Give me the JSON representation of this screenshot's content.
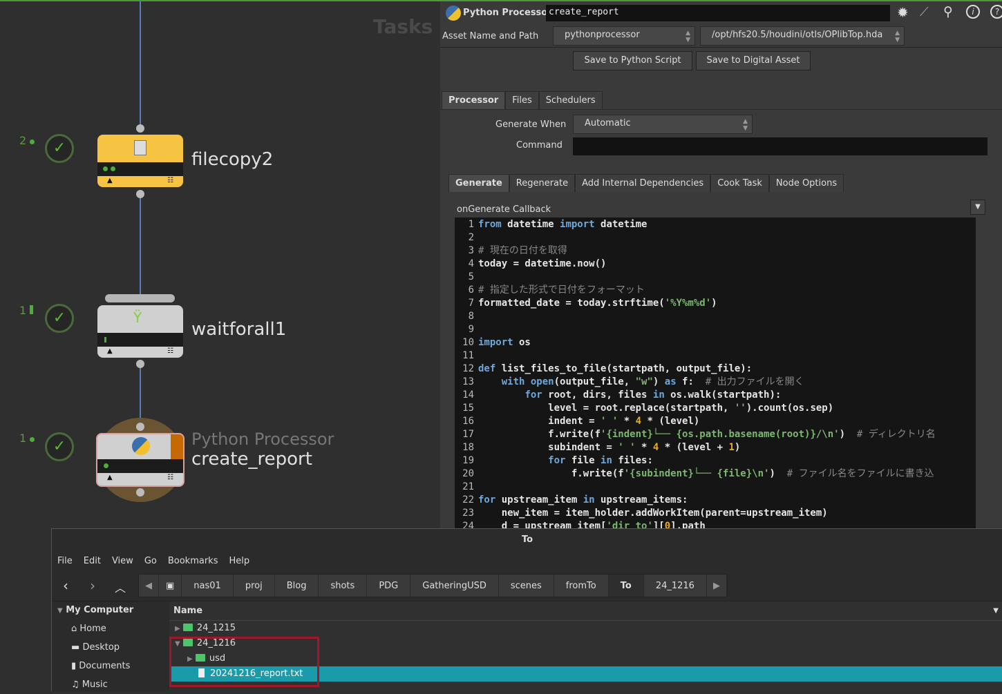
{
  "graph": {
    "watermark": "Tasks",
    "nodes": [
      {
        "name": "filecopy2",
        "count": "2",
        "type": ""
      },
      {
        "name": "waitforall1",
        "count": "1",
        "type": ""
      },
      {
        "name": "create_report",
        "count": "1",
        "type": "Python Processor"
      }
    ]
  },
  "params": {
    "node_type": "Python Processor",
    "node_name": "create_report",
    "asset_label": "Asset Name and Path",
    "asset_name": "pythonprocessor",
    "asset_path": "/opt/hfs20.5/houdini/otls/OPlibTop.hda",
    "save_python": "Save to Python Script",
    "save_asset": "Save to Digital Asset",
    "tabs": [
      "Processor",
      "Files",
      "Schedulers"
    ],
    "generate_when_label": "Generate When",
    "generate_when": "Automatic",
    "command_label": "Command",
    "command": "",
    "subtabs": [
      "Generate",
      "Regenerate",
      "Add Internal Dependencies",
      "Cook Task",
      "Node Options"
    ],
    "callback_label": "onGenerate Callback",
    "code": [
      "from datetime import datetime",
      "",
      "# 現在の日付を取得",
      "today = datetime.now()",
      "",
      "# 指定した形式で日付をフォーマット",
      "formatted_date = today.strftime('%Y%m%d')",
      "",
      "",
      "import os",
      "",
      "def list_files_to_file(startpath, output_file):",
      "    with open(output_file, \"w\") as f:  # 出力ファイルを開く",
      "        for root, dirs, files in os.walk(startpath):",
      "            level = root.replace(startpath, '').count(os.sep)",
      "            indent = ' ' * 4 * (level)",
      "            f.write(f'{indent}└── {os.path.basename(root)}/\\n')  # ディレクトリ名",
      "            subindent = ' ' * 4 * (level + 1)",
      "            for file in files:",
      "                f.write(f'{subindent}└── {file}\\n')  # ファイル名をファイルに書き込",
      "",
      "for upstream_item in upstream_items:",
      "    new_item = item_holder.addWorkItem(parent=upstream_item)",
      "    d = upstream_item['dir_to'][0].path"
    ]
  },
  "files": {
    "title": "To",
    "menu": [
      "File",
      "Edit",
      "View",
      "Go",
      "Bookmarks",
      "Help"
    ],
    "crumbs": [
      "nas01",
      "proj",
      "Blog",
      "shots",
      "PDG",
      "GatheringUSD",
      "scenes",
      "fromTo",
      "To",
      "24_1216"
    ],
    "sidebar_header": "My Computer",
    "sidebar": [
      "Home",
      "Desktop",
      "Documents",
      "Music"
    ],
    "column": "Name",
    "rows": [
      "24_1215",
      "24_1216",
      "usd",
      "20241216_report.txt"
    ],
    "selection_color": "#1b9aaa",
    "highlight_color": "#a0182a"
  }
}
